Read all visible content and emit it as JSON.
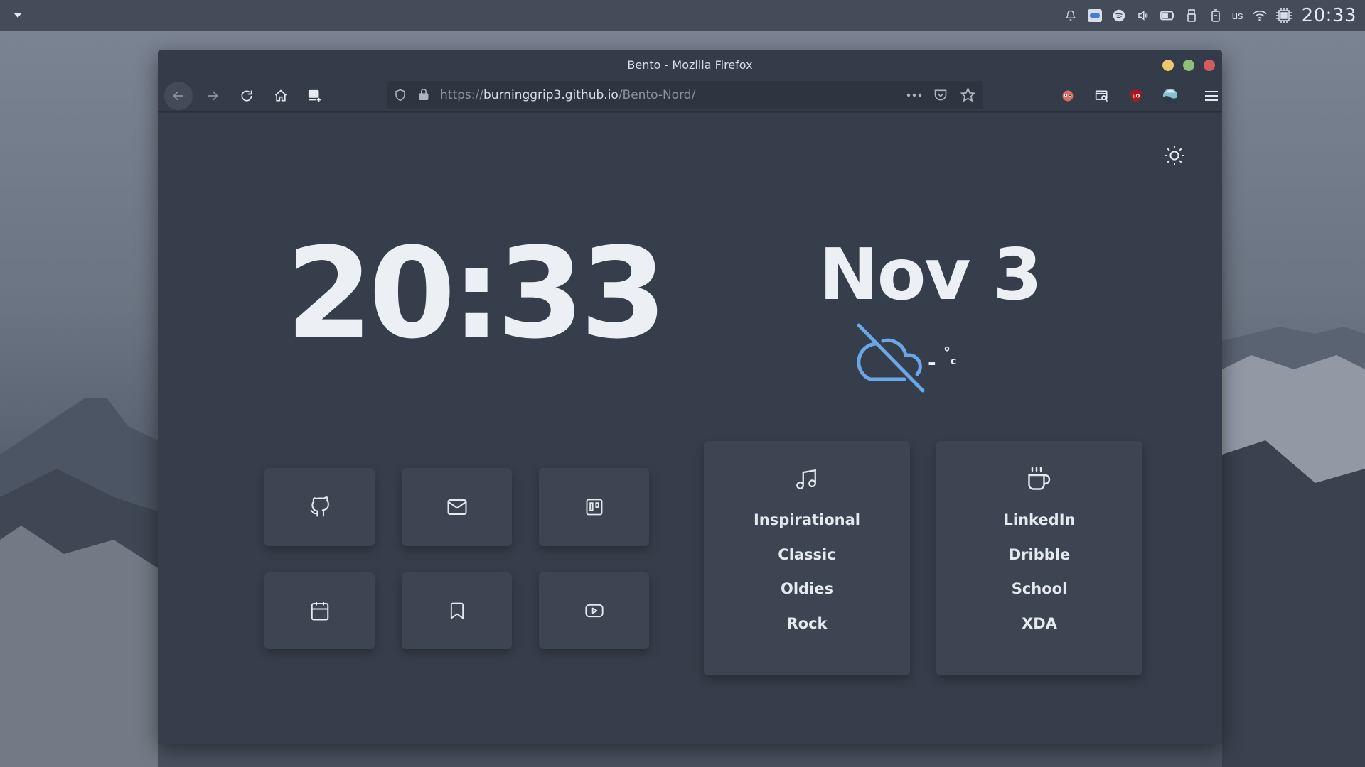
{
  "desktop": {
    "panel": {
      "layout_indicator": "us",
      "clock": "20:33",
      "tray_icons": [
        "bell-icon",
        "intel-icon",
        "spotify-icon",
        "volume-icon",
        "battery-icon",
        "usb-icon",
        "device-icon",
        "wifi-icon",
        "cpu-icon"
      ]
    }
  },
  "browser": {
    "window_title": "Bento - Mozilla Firefox",
    "url": {
      "scheme": "https://",
      "host": "burninggrip3.github.io",
      "path": "/Bento-Nord/"
    },
    "colors": {
      "close": "#d35c63",
      "maximize": "#8fbf7a",
      "minimize": "#ebc96c"
    }
  },
  "page": {
    "time": "20:33",
    "date": "Nov 3",
    "weather": {
      "icon": "cloud-off-icon",
      "temperature": "-",
      "unit_degree": "°",
      "unit_letter": "c",
      "icon_color": "#6aa7e8"
    },
    "buttons": [
      {
        "name": "github",
        "icon": "github-icon"
      },
      {
        "name": "mail",
        "icon": "mail-icon"
      },
      {
        "name": "trello",
        "icon": "trello-icon"
      },
      {
        "name": "calendar",
        "icon": "calendar-icon"
      },
      {
        "name": "bookmark",
        "icon": "bookmark-icon"
      },
      {
        "name": "youtube",
        "icon": "youtube-icon"
      }
    ],
    "lists": [
      {
        "icon": "music-note-icon",
        "links": [
          "Inspirational",
          "Classic",
          "Oldies",
          "Rock"
        ]
      },
      {
        "icon": "coffee-icon",
        "links": [
          "LinkedIn",
          "Dribble",
          "School",
          "XDA"
        ]
      }
    ]
  }
}
